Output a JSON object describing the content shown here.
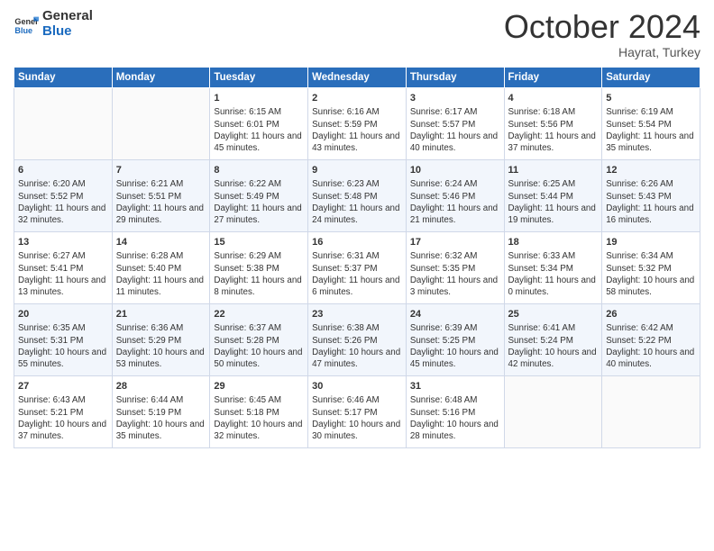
{
  "header": {
    "logo_general": "General",
    "logo_blue": "Blue",
    "month": "October 2024",
    "location": "Hayrat, Turkey"
  },
  "weekdays": [
    "Sunday",
    "Monday",
    "Tuesday",
    "Wednesday",
    "Thursday",
    "Friday",
    "Saturday"
  ],
  "weeks": [
    [
      {
        "day": "",
        "sunrise": "",
        "sunset": "",
        "daylight": ""
      },
      {
        "day": "",
        "sunrise": "",
        "sunset": "",
        "daylight": ""
      },
      {
        "day": "1",
        "sunrise": "Sunrise: 6:15 AM",
        "sunset": "Sunset: 6:01 PM",
        "daylight": "Daylight: 11 hours and 45 minutes."
      },
      {
        "day": "2",
        "sunrise": "Sunrise: 6:16 AM",
        "sunset": "Sunset: 5:59 PM",
        "daylight": "Daylight: 11 hours and 43 minutes."
      },
      {
        "day": "3",
        "sunrise": "Sunrise: 6:17 AM",
        "sunset": "Sunset: 5:57 PM",
        "daylight": "Daylight: 11 hours and 40 minutes."
      },
      {
        "day": "4",
        "sunrise": "Sunrise: 6:18 AM",
        "sunset": "Sunset: 5:56 PM",
        "daylight": "Daylight: 11 hours and 37 minutes."
      },
      {
        "day": "5",
        "sunrise": "Sunrise: 6:19 AM",
        "sunset": "Sunset: 5:54 PM",
        "daylight": "Daylight: 11 hours and 35 minutes."
      }
    ],
    [
      {
        "day": "6",
        "sunrise": "Sunrise: 6:20 AM",
        "sunset": "Sunset: 5:52 PM",
        "daylight": "Daylight: 11 hours and 32 minutes."
      },
      {
        "day": "7",
        "sunrise": "Sunrise: 6:21 AM",
        "sunset": "Sunset: 5:51 PM",
        "daylight": "Daylight: 11 hours and 29 minutes."
      },
      {
        "day": "8",
        "sunrise": "Sunrise: 6:22 AM",
        "sunset": "Sunset: 5:49 PM",
        "daylight": "Daylight: 11 hours and 27 minutes."
      },
      {
        "day": "9",
        "sunrise": "Sunrise: 6:23 AM",
        "sunset": "Sunset: 5:48 PM",
        "daylight": "Daylight: 11 hours and 24 minutes."
      },
      {
        "day": "10",
        "sunrise": "Sunrise: 6:24 AM",
        "sunset": "Sunset: 5:46 PM",
        "daylight": "Daylight: 11 hours and 21 minutes."
      },
      {
        "day": "11",
        "sunrise": "Sunrise: 6:25 AM",
        "sunset": "Sunset: 5:44 PM",
        "daylight": "Daylight: 11 hours and 19 minutes."
      },
      {
        "day": "12",
        "sunrise": "Sunrise: 6:26 AM",
        "sunset": "Sunset: 5:43 PM",
        "daylight": "Daylight: 11 hours and 16 minutes."
      }
    ],
    [
      {
        "day": "13",
        "sunrise": "Sunrise: 6:27 AM",
        "sunset": "Sunset: 5:41 PM",
        "daylight": "Daylight: 11 hours and 13 minutes."
      },
      {
        "day": "14",
        "sunrise": "Sunrise: 6:28 AM",
        "sunset": "Sunset: 5:40 PM",
        "daylight": "Daylight: 11 hours and 11 minutes."
      },
      {
        "day": "15",
        "sunrise": "Sunrise: 6:29 AM",
        "sunset": "Sunset: 5:38 PM",
        "daylight": "Daylight: 11 hours and 8 minutes."
      },
      {
        "day": "16",
        "sunrise": "Sunrise: 6:31 AM",
        "sunset": "Sunset: 5:37 PM",
        "daylight": "Daylight: 11 hours and 6 minutes."
      },
      {
        "day": "17",
        "sunrise": "Sunrise: 6:32 AM",
        "sunset": "Sunset: 5:35 PM",
        "daylight": "Daylight: 11 hours and 3 minutes."
      },
      {
        "day": "18",
        "sunrise": "Sunrise: 6:33 AM",
        "sunset": "Sunset: 5:34 PM",
        "daylight": "Daylight: 11 hours and 0 minutes."
      },
      {
        "day": "19",
        "sunrise": "Sunrise: 6:34 AM",
        "sunset": "Sunset: 5:32 PM",
        "daylight": "Daylight: 10 hours and 58 minutes."
      }
    ],
    [
      {
        "day": "20",
        "sunrise": "Sunrise: 6:35 AM",
        "sunset": "Sunset: 5:31 PM",
        "daylight": "Daylight: 10 hours and 55 minutes."
      },
      {
        "day": "21",
        "sunrise": "Sunrise: 6:36 AM",
        "sunset": "Sunset: 5:29 PM",
        "daylight": "Daylight: 10 hours and 53 minutes."
      },
      {
        "day": "22",
        "sunrise": "Sunrise: 6:37 AM",
        "sunset": "Sunset: 5:28 PM",
        "daylight": "Daylight: 10 hours and 50 minutes."
      },
      {
        "day": "23",
        "sunrise": "Sunrise: 6:38 AM",
        "sunset": "Sunset: 5:26 PM",
        "daylight": "Daylight: 10 hours and 47 minutes."
      },
      {
        "day": "24",
        "sunrise": "Sunrise: 6:39 AM",
        "sunset": "Sunset: 5:25 PM",
        "daylight": "Daylight: 10 hours and 45 minutes."
      },
      {
        "day": "25",
        "sunrise": "Sunrise: 6:41 AM",
        "sunset": "Sunset: 5:24 PM",
        "daylight": "Daylight: 10 hours and 42 minutes."
      },
      {
        "day": "26",
        "sunrise": "Sunrise: 6:42 AM",
        "sunset": "Sunset: 5:22 PM",
        "daylight": "Daylight: 10 hours and 40 minutes."
      }
    ],
    [
      {
        "day": "27",
        "sunrise": "Sunrise: 6:43 AM",
        "sunset": "Sunset: 5:21 PM",
        "daylight": "Daylight: 10 hours and 37 minutes."
      },
      {
        "day": "28",
        "sunrise": "Sunrise: 6:44 AM",
        "sunset": "Sunset: 5:19 PM",
        "daylight": "Daylight: 10 hours and 35 minutes."
      },
      {
        "day": "29",
        "sunrise": "Sunrise: 6:45 AM",
        "sunset": "Sunset: 5:18 PM",
        "daylight": "Daylight: 10 hours and 32 minutes."
      },
      {
        "day": "30",
        "sunrise": "Sunrise: 6:46 AM",
        "sunset": "Sunset: 5:17 PM",
        "daylight": "Daylight: 10 hours and 30 minutes."
      },
      {
        "day": "31",
        "sunrise": "Sunrise: 6:48 AM",
        "sunset": "Sunset: 5:16 PM",
        "daylight": "Daylight: 10 hours and 28 minutes."
      },
      {
        "day": "",
        "sunrise": "",
        "sunset": "",
        "daylight": ""
      },
      {
        "day": "",
        "sunrise": "",
        "sunset": "",
        "daylight": ""
      }
    ]
  ]
}
